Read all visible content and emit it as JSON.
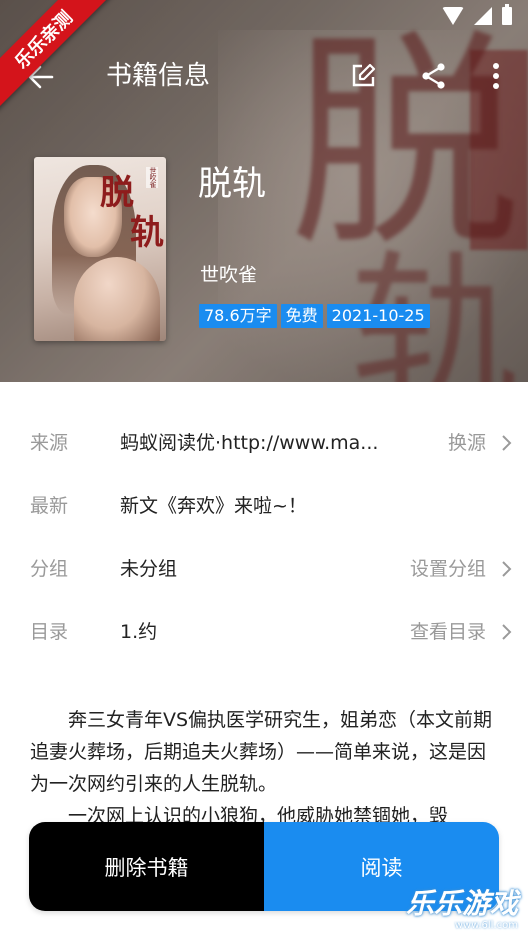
{
  "watermark": {
    "ribbon": "乐乐亲测",
    "brand": "乐乐游戏",
    "url": "www.6ll.com"
  },
  "toolbar": {
    "title": "书籍信息",
    "icons": [
      "back-arrow-icon",
      "edit-icon",
      "share-icon",
      "more-vert-icon"
    ]
  },
  "book": {
    "cover_title_1": "脱",
    "cover_title_2": "轨",
    "cover_author": "世吹雀",
    "title": "脱轨",
    "author": "世吹雀",
    "tags": [
      "78.6万字",
      "免费",
      "2021-10-25"
    ]
  },
  "info": {
    "source": {
      "label": "来源",
      "value": "蚂蚁阅读优·http://www.ma...",
      "action": "换源"
    },
    "latest": {
      "label": "最新",
      "value": "新文《奔欢》来啦~！"
    },
    "group": {
      "label": "分组",
      "value": "未分组",
      "action": "设置分组"
    },
    "toc": {
      "label": "目录",
      "value": "1.约",
      "action": "查看目录"
    }
  },
  "description": {
    "p1": "奔三女青年VS偏执医学研究生，姐弟恋（本文前期追妻火葬场，后期追夫火葬场）——简单来说，这是因为一次网约引来的人生脱轨。",
    "p2": "一次网上认识的小狼狗，他威胁她禁锢她，毁"
  },
  "actions": {
    "delete": "删除书籍",
    "read": "阅读"
  },
  "colors": {
    "accent": "#1a8cf0",
    "delete_bg": "#000000",
    "label": "#9a9a9a",
    "ribbon": "#d4141b"
  }
}
